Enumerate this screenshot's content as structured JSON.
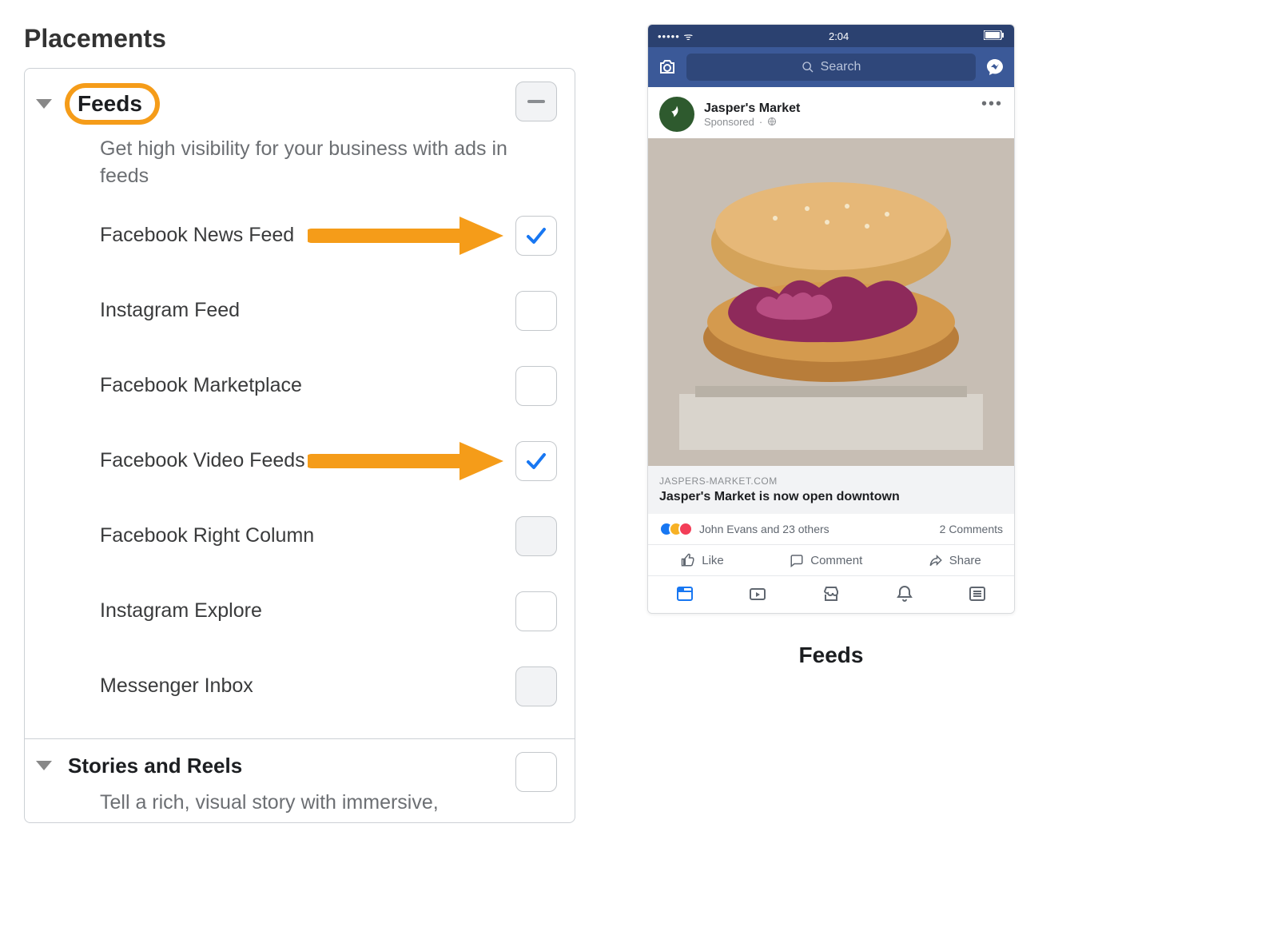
{
  "page_title": "Placements",
  "sections": {
    "feeds": {
      "title": "Feeds",
      "description": "Get high visibility for your business with ads in feeds",
      "state": "indeterminate",
      "options": [
        {
          "label": "Facebook News Feed",
          "checked": true,
          "disabled": false,
          "annotated": true
        },
        {
          "label": "Instagram Feed",
          "checked": false,
          "disabled": false,
          "annotated": false
        },
        {
          "label": "Facebook Marketplace",
          "checked": false,
          "disabled": false,
          "annotated": false
        },
        {
          "label": "Facebook Video Feeds",
          "checked": true,
          "disabled": false,
          "annotated": true
        },
        {
          "label": "Facebook Right Column",
          "checked": false,
          "disabled": true,
          "annotated": false
        },
        {
          "label": "Instagram Explore",
          "checked": false,
          "disabled": false,
          "annotated": false
        },
        {
          "label": "Messenger Inbox",
          "checked": false,
          "disabled": true,
          "annotated": false
        }
      ]
    },
    "stories": {
      "title": "Stories and Reels",
      "description": "Tell a rich, visual story with immersive,"
    }
  },
  "preview": {
    "status_time": "2:04",
    "search_placeholder": "Search",
    "advertiser": "Jasper's Market",
    "sponsored_label": "Sponsored",
    "link_domain": "JASPERS-MARKET.COM",
    "link_title": "Jasper's Market is now open downtown",
    "reactions_text": "John Evans and 23 others",
    "comments_text": "2 Comments",
    "actions": {
      "like": "Like",
      "comment": "Comment",
      "share": "Share"
    },
    "caption": "Feeds"
  }
}
